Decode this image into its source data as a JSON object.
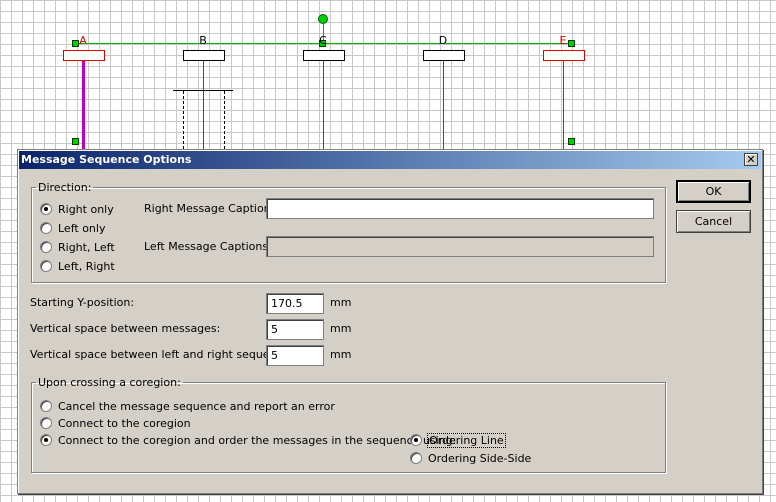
{
  "diagram": {
    "lifelines": [
      {
        "label": "A",
        "selected": true
      },
      {
        "label": "B",
        "selected": false
      },
      {
        "label": "C",
        "selected": false
      },
      {
        "label": "D",
        "selected": false
      },
      {
        "label": "E",
        "selected": true
      }
    ],
    "colors": {
      "lifeline": "#c000c0",
      "selection": "#e00000",
      "handle": "#00d000",
      "connector": "#00b400"
    }
  },
  "dialog": {
    "title": "Message Sequence Options",
    "close_glyph": "✕",
    "ok_label": "OK",
    "cancel_label": "Cancel",
    "direction": {
      "legend": "Direction:",
      "options": [
        {
          "label": "Right only",
          "selected": true
        },
        {
          "label": "Left only",
          "selected": false
        },
        {
          "label": "Right, Left",
          "selected": false
        },
        {
          "label": "Left, Right",
          "selected": false
        }
      ],
      "right_captions_label": "Right Message Captions:",
      "right_captions_value": "",
      "left_captions_label": "Left Message Captions:",
      "left_captions_value": ""
    },
    "starting_y": {
      "label": "Starting Y-position:",
      "value": "170.5",
      "unit": "mm"
    },
    "vspace_messages": {
      "label": "Vertical space between messages:",
      "value": "5",
      "unit": "mm"
    },
    "vspace_sequences": {
      "label": "Vertical space between left and right sequence:",
      "value": "5",
      "unit": "mm"
    },
    "coregion": {
      "legend": "Upon crossing a coregion:",
      "options": [
        {
          "label": "Cancel the message sequence and report an error",
          "selected": false
        },
        {
          "label": "Connect to the coregion",
          "selected": false
        },
        {
          "label": "Connect to the coregion and order the messages in the sequence using:",
          "selected": true
        }
      ],
      "ordering": [
        {
          "label": "Ordering Line",
          "selected": true
        },
        {
          "label": "Ordering Side-Side",
          "selected": false
        }
      ]
    }
  }
}
